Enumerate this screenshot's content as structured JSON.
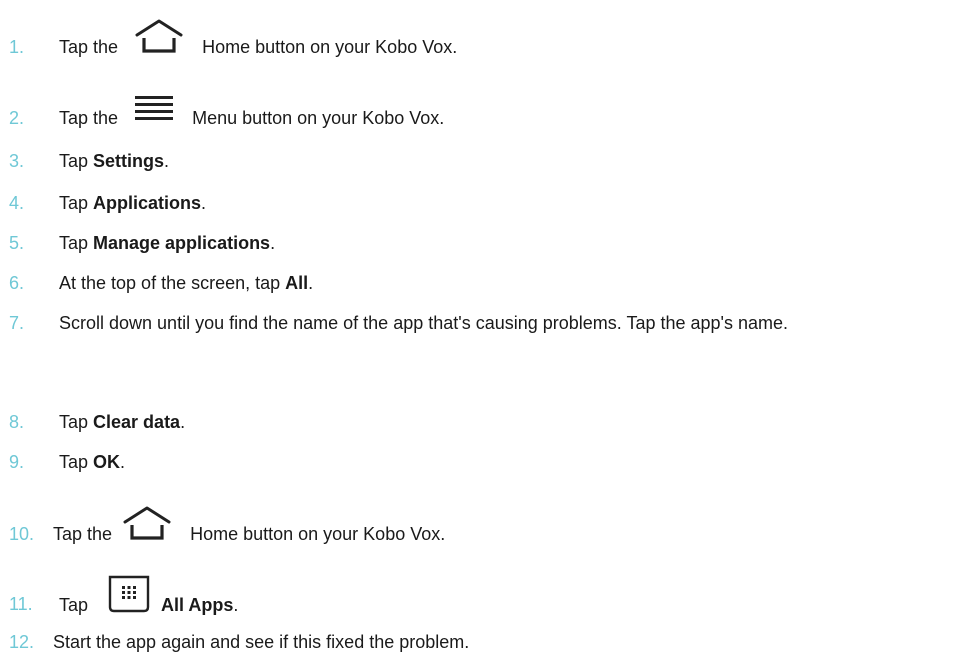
{
  "steps": [
    {
      "number": "1.",
      "before": "Tap the",
      "after": "Home button on your Kobo Vox.",
      "icon": "home-icon"
    },
    {
      "number": "2.",
      "before": "Tap the",
      "after": "Menu button on your Kobo Vox.",
      "icon": "menu-icon"
    },
    {
      "number": "3.",
      "before": "Tap ",
      "bold": "Settings",
      "after": "."
    },
    {
      "number": "4.",
      "before": "Tap ",
      "bold": "Applications",
      "after": "."
    },
    {
      "number": "5.",
      "before": "Tap ",
      "bold": "Manage applications",
      "after": "."
    },
    {
      "number": "6.",
      "before": "At the top of the screen, tap ",
      "bold": "All",
      "after": "."
    },
    {
      "number": "7.",
      "text": "Scroll down until you find the name of the app that's causing problems. Tap the app's name."
    },
    {
      "number": "8.",
      "before": "Tap ",
      "bold": "Clear data",
      "after": "."
    },
    {
      "number": "9.",
      "before": "Tap ",
      "bold": "OK",
      "after": "."
    },
    {
      "number": "10.",
      "before": "Tap the",
      "after": "Home button on your Kobo Vox.",
      "icon": "home-icon"
    },
    {
      "number": "11.",
      "before": "Tap",
      "bold": "All Apps",
      "after": ".",
      "icon": "all-apps-icon"
    },
    {
      "number": "12.",
      "text": "Start the app again and see if this fixed the problem."
    }
  ],
  "colors": {
    "number": "#6fc8d6",
    "text": "#1a1a1a"
  }
}
